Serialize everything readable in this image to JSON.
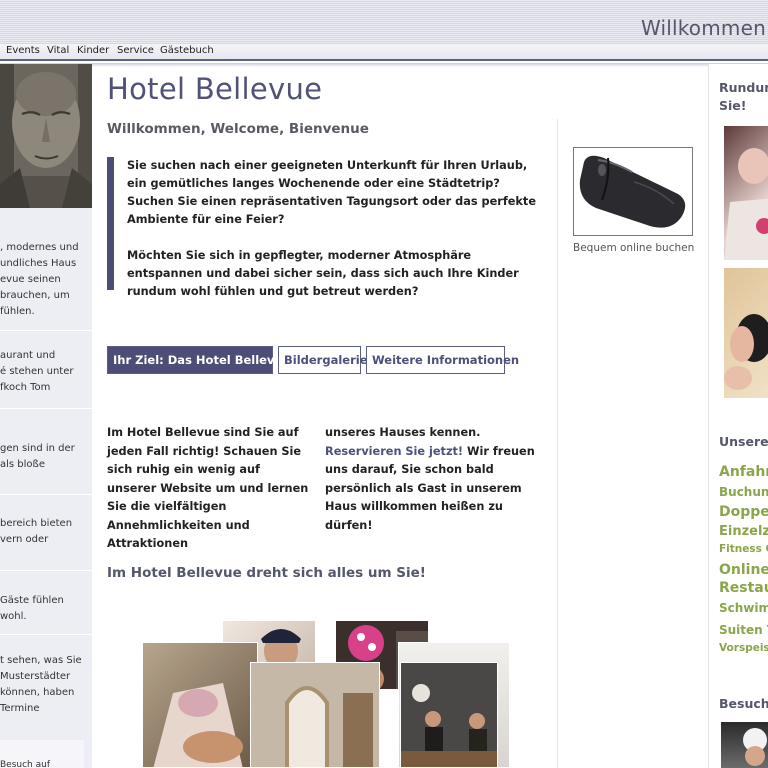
{
  "header": {
    "headline": "Willkommen"
  },
  "nav": {
    "items": [
      "Events",
      "Vital",
      "Kinder",
      "Service",
      "Gästebuch"
    ]
  },
  "left": {
    "paragraphs": [
      [
        ", modernes und",
        "undliches Haus",
        "evue seinen",
        " brauchen, um",
        "fühlen."
      ],
      [
        "aurant und",
        "é stehen unter",
        "fkoch Tom"
      ],
      [
        "gen sind in der",
        "als bloße"
      ],
      [
        "bereich bieten",
        "vern oder"
      ],
      [
        " Gäste fühlen",
        " wohl."
      ],
      [
        "t sehen, was Sie",
        " Musterstädter",
        " können, haben",
        " Termine"
      ]
    ],
    "more": "Besuch auf"
  },
  "main": {
    "title": "Hotel Bellevue",
    "subtitle": "Willkommen, Welcome, Bienvenue",
    "intro": {
      "p1": "Sie suchen nach einer geeigneten Unterkunft für Ihren Urlaub, ein gemütliches langes Wochenende oder eine Städtetrip? Suchen Sie einen repräsentativen Tagungsort oder das perfekte Ambiente für eine Feier?",
      "p2": "Möchten Sie sich in gepflegter, moderner Atmosphäre entspannen und dabei sicher sein, dass sich auch Ihre Kinder rundum wohl fühlen und gut betreut werden?"
    },
    "tabs": [
      "Ihr Ziel: Das Hotel Bellevue",
      "Bildergalerie",
      "Weitere Informationen"
    ],
    "col1": "Im Hotel Bellevue sind Sie auf jeden Fall richtig! Schauen Sie sich ruhig ein wenig auf unserer Website um und lernen Sie die vielfältigen Annehmlichkeiten und Attraktionen",
    "col2_text_a": "unseres Hauses kennen. ",
    "col2_link": "Reservieren Sie jetzt!",
    "col2_text_b": " Wir freuen uns darauf, Sie schon bald persönlich als Gast in unserem Haus willkommen heißen zu dürfen!",
    "section_heading": "Im Hotel Bellevue dreht sich alles um Sie!"
  },
  "promo": {
    "caption": "Bequem online buchen"
  },
  "right": {
    "intro": [
      "Rundum",
      "Sie!"
    ],
    "heading": "Unsere I",
    "links": [
      {
        "text": "Anfahrt",
        "size": 14
      },
      {
        "text": "Buchung",
        "size": 12
      },
      {
        "text": "Doppel",
        "size": 14
      },
      {
        "text": "Einzelzi",
        "size": 13
      },
      {
        "text": "Fitness C",
        "size": 10.5
      },
      {
        "text": "Online-",
        "size": 14
      },
      {
        "text": "Restau",
        "size": 14
      },
      {
        "text": "Schwimm",
        "size": 12
      },
      {
        "text": "Suiten T",
        "size": 12
      },
      {
        "text": "Vorspeise",
        "size": 10.5
      }
    ],
    "visit_heading": "Besuche"
  }
}
